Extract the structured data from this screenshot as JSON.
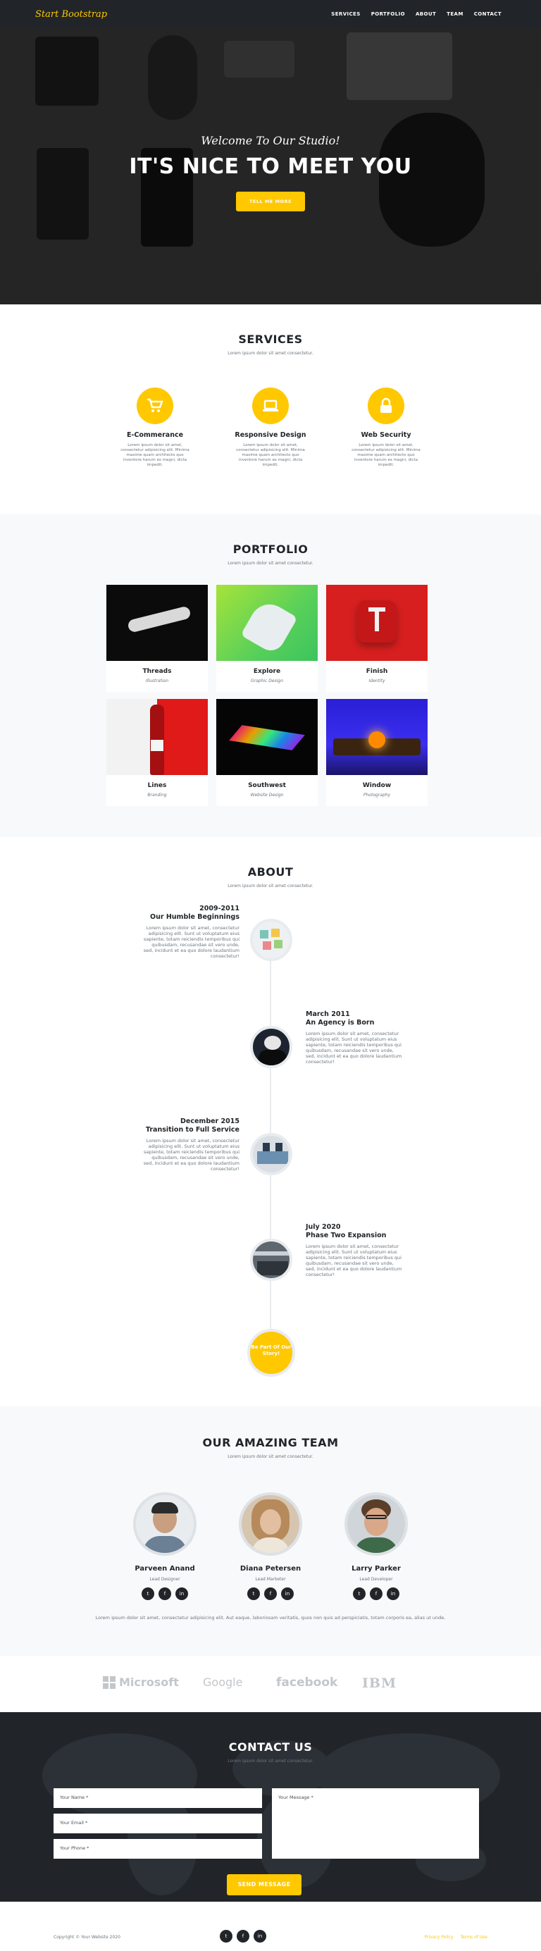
{
  "nav": {
    "brand": "Start Bootstrap",
    "links": [
      "SERVICES",
      "PORTFOLIO",
      "ABOUT",
      "TEAM",
      "CONTACT"
    ]
  },
  "hero": {
    "subheading": "Welcome To Our Studio!",
    "heading": "IT'S NICE TO MEET YOU",
    "button": "TELL ME MORE"
  },
  "services": {
    "title": "SERVICES",
    "subtitle": "Lorem ipsum dolor sit amet consectetur.",
    "items": [
      {
        "name": "E-Commerance",
        "icon": "shopping-cart-icon",
        "desc": "Lorem ipsum dolor sit amet, consectetur adipisicing elit. Minima maxime quam architecto quo inventore harum ex magni, dicta impedit."
      },
      {
        "name": "Responsive Design",
        "icon": "laptop-icon",
        "desc": "Lorem ipsum dolor sit amet, consectetur adipisicing elit. Minima maxime quam architecto quo inventore harum ex magni, dicta impedit."
      },
      {
        "name": "Web Security",
        "icon": "lock-icon",
        "desc": "Lorem ipsum dolor sit amet, consectetur adipisicing elit. Minima maxime quam architecto quo inventore harum ex magni, dicta impedit."
      }
    ]
  },
  "portfolio": {
    "title": "PORTFOLIO",
    "subtitle": "Lorem ipsum dolor sit amet consectetur.",
    "items": [
      {
        "name": "Threads",
        "category": "Illustration"
      },
      {
        "name": "Explore",
        "category": "Graphic Design"
      },
      {
        "name": "Finish",
        "category": "Identity"
      },
      {
        "name": "Lines",
        "category": "Branding"
      },
      {
        "name": "Southwest",
        "category": "Website Design"
      },
      {
        "name": "Window",
        "category": "Photography"
      }
    ]
  },
  "about": {
    "title": "ABOUT",
    "subtitle": "Lorem ipsum dolor sit amet consectetur.",
    "timeline": [
      {
        "date": "2009-2011",
        "heading": "Our Humble Beginnings",
        "body": "Lorem ipsum dolor sit amet, consectetur adipisicing elit. Sunt ut voluptatum eius sapiente, totam reiciendis temporibus qui quibusdam, recusandae sit vero unde, sed, incidunt et ea quo dolore laudantium consectetur!"
      },
      {
        "date": "March 2011",
        "heading": "An Agency is Born",
        "body": "Lorem ipsum dolor sit amet, consectetur adipisicing elit. Sunt ut voluptatum eius sapiente, totam reiciendis temporibus qui quibusdam, recusandae sit vero unde, sed, incidunt et ea quo dolore laudantium consectetur!"
      },
      {
        "date": "December 2015",
        "heading": "Transition to Full Service",
        "body": "Lorem ipsum dolor sit amet, consectetur adipisicing elit. Sunt ut voluptatum eius sapiente, totam reiciendis temporibus qui quibusdam, recusandae sit vero unde, sed, incidunt et ea quo dolore laudantium consectetur!"
      },
      {
        "date": "July 2020",
        "heading": "Phase Two Expansion",
        "body": "Lorem ipsum dolor sit amet, consectetur adipisicing elit. Sunt ut voluptatum eius sapiente, totam reiciendis temporibus qui quibusdam, recusandae sit vero unde, sed, incidunt et ea quo dolore laudantium consectetur!"
      }
    ],
    "final": "Be Part Of Our Story!"
  },
  "team": {
    "title": "OUR AMAZING TEAM",
    "subtitle": "Lorem ipsum dolor sit amet consectetur.",
    "members": [
      {
        "name": "Parveen Anand",
        "role": "Lead Designer"
      },
      {
        "name": "Diana Petersen",
        "role": "Lead Marketer"
      },
      {
        "name": "Larry Parker",
        "role": "Lead Developer"
      }
    ],
    "social": [
      "t",
      "f",
      "in"
    ],
    "note": "Lorem ipsum dolor sit amet, consectetur adipisicing elit. Aut eaque, laboriosam veritatis, quos non quis ad perspiciatis, totam corporis ea, alias ut unde."
  },
  "clients": [
    "Microsoft",
    "Google",
    "facebook",
    "IBM"
  ],
  "contact": {
    "title": "CONTACT US",
    "subtitle": "Lorem ipsum dolor sit amet consectetur.",
    "name_placeholder": "Your Name *",
    "email_placeholder": "Your Email *",
    "phone_placeholder": "Your Phone *",
    "message_placeholder": "Your Message *",
    "button": "SEND MESSAGE"
  },
  "footer": {
    "copyright": "Copyright © Your Website 2020",
    "social": [
      "t",
      "f",
      "in"
    ],
    "privacy": "Privacy Policy",
    "terms": "Terms of Use"
  },
  "colors": {
    "accent": "#ffc800",
    "dark": "#212529",
    "light": "#f8f9fa"
  }
}
